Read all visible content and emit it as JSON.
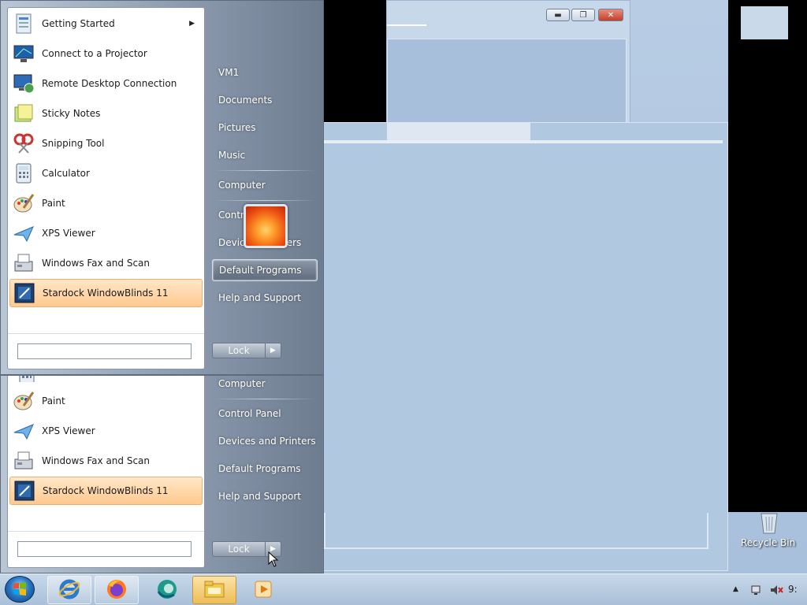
{
  "start_menu_top": {
    "programs": [
      {
        "label": "Getting Started",
        "icon": "getting-started-icon",
        "has_submenu": true
      },
      {
        "label": "Connect to a Projector",
        "icon": "projector-icon"
      },
      {
        "label": "Remote Desktop Connection",
        "icon": "remote-desktop-icon"
      },
      {
        "label": "Sticky Notes",
        "icon": "sticky-notes-icon"
      },
      {
        "label": "Snipping Tool",
        "icon": "snipping-tool-icon"
      },
      {
        "label": "Calculator",
        "icon": "calculator-icon"
      },
      {
        "label": "Paint",
        "icon": "paint-icon"
      },
      {
        "label": "XPS Viewer",
        "icon": "xps-viewer-icon"
      },
      {
        "label": "Windows Fax and Scan",
        "icon": "fax-scan-icon"
      },
      {
        "label": "Stardock WindowBlinds 11",
        "icon": "windowblinds-icon",
        "selected": true
      }
    ],
    "right_items": [
      "VM1",
      "Documents",
      "Pictures",
      "Music",
      "Computer",
      "Contro",
      "Device",
      "Default Programs",
      "Help and Support"
    ],
    "right_items_suffix": {
      "devices_tail": "ters"
    },
    "highlighted": "Default Programs",
    "lock_label": "Lock"
  },
  "start_menu_bottom": {
    "programs": [
      {
        "label": "Paint",
        "icon": "paint-icon"
      },
      {
        "label": "XPS Viewer",
        "icon": "xps-viewer-icon"
      },
      {
        "label": "Windows Fax and Scan",
        "icon": "fax-scan-icon"
      },
      {
        "label": "Stardock WindowBlinds 11",
        "icon": "windowblinds-icon",
        "selected": true
      }
    ],
    "right_items": [
      "Computer",
      "Control Panel",
      "Devices and Printers",
      "Default Programs",
      "Help and Support"
    ],
    "lock_label": "Lock"
  },
  "desktop": {
    "recycle_bin_label": "Recycle Bin"
  },
  "taskbar": {
    "apps": [
      "internet-explorer-icon",
      "firefox-icon",
      "edge-like-icon",
      "file-explorer-icon",
      "media-player-icon"
    ],
    "clock_partial": "9:"
  },
  "colors": {
    "selected_item": "#ffc98f",
    "start_menu_right": "#7e8c9f",
    "desktop": "#a9c2dc"
  }
}
